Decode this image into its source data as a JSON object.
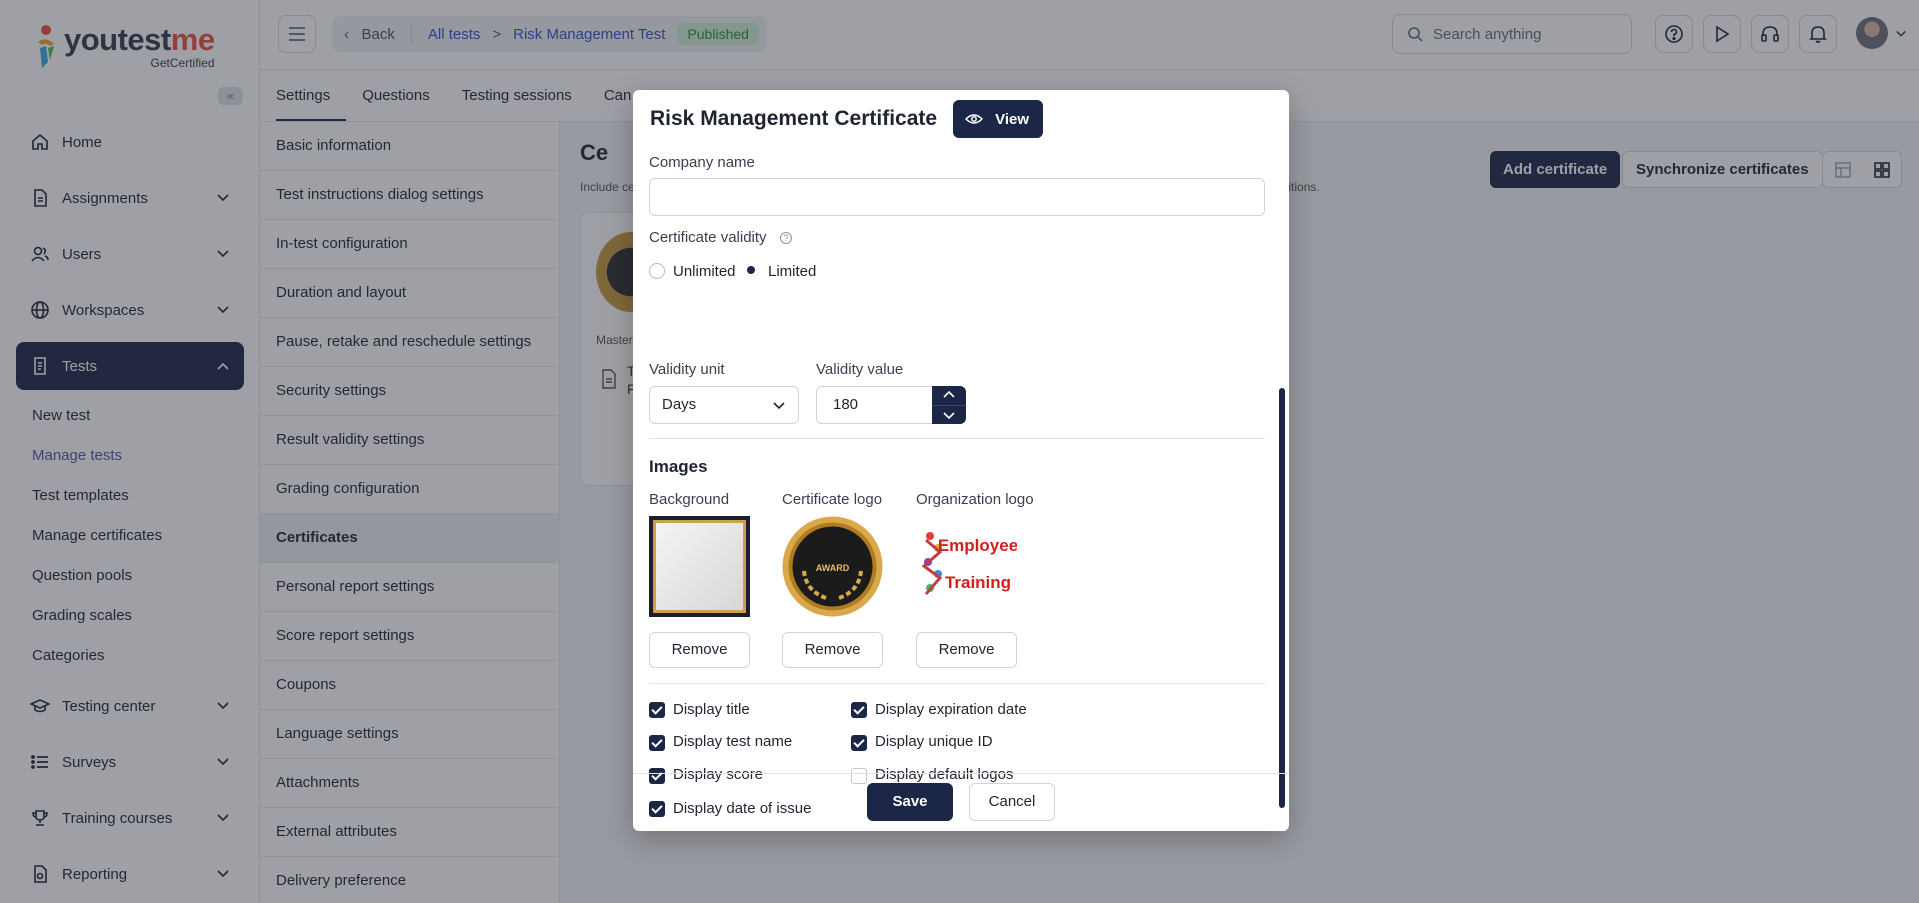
{
  "brand": {
    "name_part1": "youtest",
    "name_part2": "me",
    "tagline": "GetCertified"
  },
  "sidebar": {
    "items": [
      {
        "label": "Home",
        "icon": "home-icon"
      },
      {
        "label": "Assignments",
        "icon": "document-icon"
      },
      {
        "label": "Users",
        "icon": "users-icon"
      },
      {
        "label": "Workspaces",
        "icon": "globe-icon"
      },
      {
        "label": "Tests",
        "icon": "test-icon"
      },
      {
        "label": "Testing center",
        "icon": "graduation-cap-icon"
      },
      {
        "label": "Surveys",
        "icon": "list-icon"
      },
      {
        "label": "Training courses",
        "icon": "trophy-icon"
      },
      {
        "label": "Reporting",
        "icon": "report-icon"
      }
    ],
    "tests_submenu": [
      "New test",
      "Manage tests",
      "Test templates",
      "Manage certificates",
      "Question pools",
      "Grading scales",
      "Categories"
    ]
  },
  "topbar": {
    "back": "Back",
    "crumb_all_tests": "All tests",
    "crumb_separator": ">",
    "crumb_test": "Risk Management Test",
    "status": "Published",
    "search_placeholder": "Search anything"
  },
  "tabs": [
    "Settings",
    "Questions",
    "Testing sessions",
    "Can"
  ],
  "settings_list": [
    "Basic information",
    "Test instructions dialog settings",
    "In-test configuration",
    "Duration and layout",
    "Pause, retake and reschedule settings",
    "Security settings",
    "Result validity settings",
    "Grading configuration",
    "Certificates",
    "Personal report settings",
    "Score report settings",
    "Coupons",
    "Language settings",
    "Attachments",
    "External attributes",
    "Delivery preference"
  ],
  "content": {
    "title": "Ce",
    "desc_start": "Include ce",
    "desc_end": "nditions.",
    "add_certificate": "Add certificate",
    "synchronize": "Synchronize certificates",
    "card_label": "Master",
    "card_t": "T",
    "card_f": "F"
  },
  "modal": {
    "title": "Risk Management Certificate",
    "view_button": "View",
    "company_name_label": "Company name",
    "company_name_value": "",
    "validity_label": "Certificate validity",
    "validity_options": [
      "Unlimited",
      "Limited"
    ],
    "validity_selected": "Limited",
    "validity_unit_label": "Validity unit",
    "validity_unit_value": "Days",
    "validity_value_label": "Validity value",
    "validity_value": "180",
    "images_heading": "Images",
    "image_labels": [
      "Background",
      "Certificate logo",
      "Organization logo"
    ],
    "award_text": "AWARD",
    "org_logo_line1": "Employee",
    "org_logo_line2": "Training",
    "remove_label": "Remove",
    "checkboxes": [
      {
        "label": "Display title",
        "checked": true
      },
      {
        "label": "Display expiration date",
        "checked": true
      },
      {
        "label": "Display test name",
        "checked": true
      },
      {
        "label": "Display unique ID",
        "checked": true
      },
      {
        "label": "Display score",
        "checked": true
      },
      {
        "label": "Display default logos",
        "checked": false
      },
      {
        "label": "Display date of issue",
        "checked": true
      }
    ],
    "save": "Save",
    "cancel": "Cancel"
  }
}
